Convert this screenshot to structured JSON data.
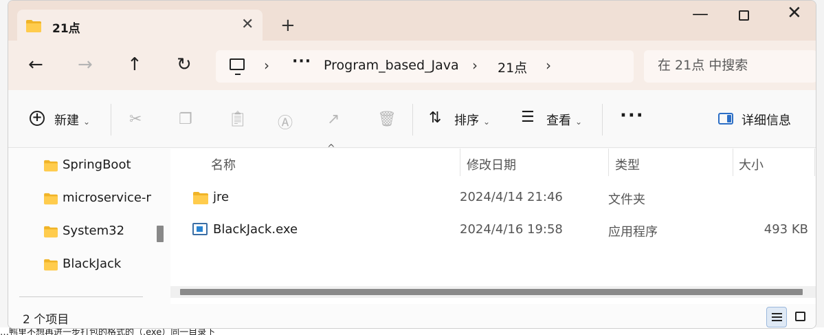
{
  "window": {
    "tab_title": "21点",
    "new_tab_symbol": "+",
    "tab_close_symbol": "✕"
  },
  "address": {
    "more": "···",
    "crumbs": [
      "Program_based_Java",
      "21点"
    ],
    "separator": "›"
  },
  "search": {
    "placeholder": "在 21点 中搜索"
  },
  "toolbar": {
    "new_label": "新建",
    "sort_label": "排序",
    "view_label": "查看",
    "more_label": "···",
    "details_label": "详细信息"
  },
  "nav_pane": {
    "items": [
      {
        "label": "SpringBoot",
        "pinned": true
      },
      {
        "label": "microservice-m"
      },
      {
        "label": "System32"
      },
      {
        "label": "BlackJack"
      }
    ]
  },
  "file_list": {
    "columns": {
      "name": "名称",
      "date": "修改日期",
      "type": "类型",
      "size": "大小"
    },
    "rows": [
      {
        "name": "jre",
        "date": "2024/4/14 21:46",
        "type": "文件夹",
        "size": "",
        "icon": "folder-icon"
      },
      {
        "name": "BlackJack.exe",
        "date": "2024/4/16 19:58",
        "type": "应用程序",
        "size": "493 KB",
        "icon": "exe-icon"
      }
    ]
  },
  "status": {
    "item_count": "2 个项目"
  },
  "background_doc": {
    "line": "…鸭里不想再进一步打包的格式的（.exe）同一目录下"
  }
}
